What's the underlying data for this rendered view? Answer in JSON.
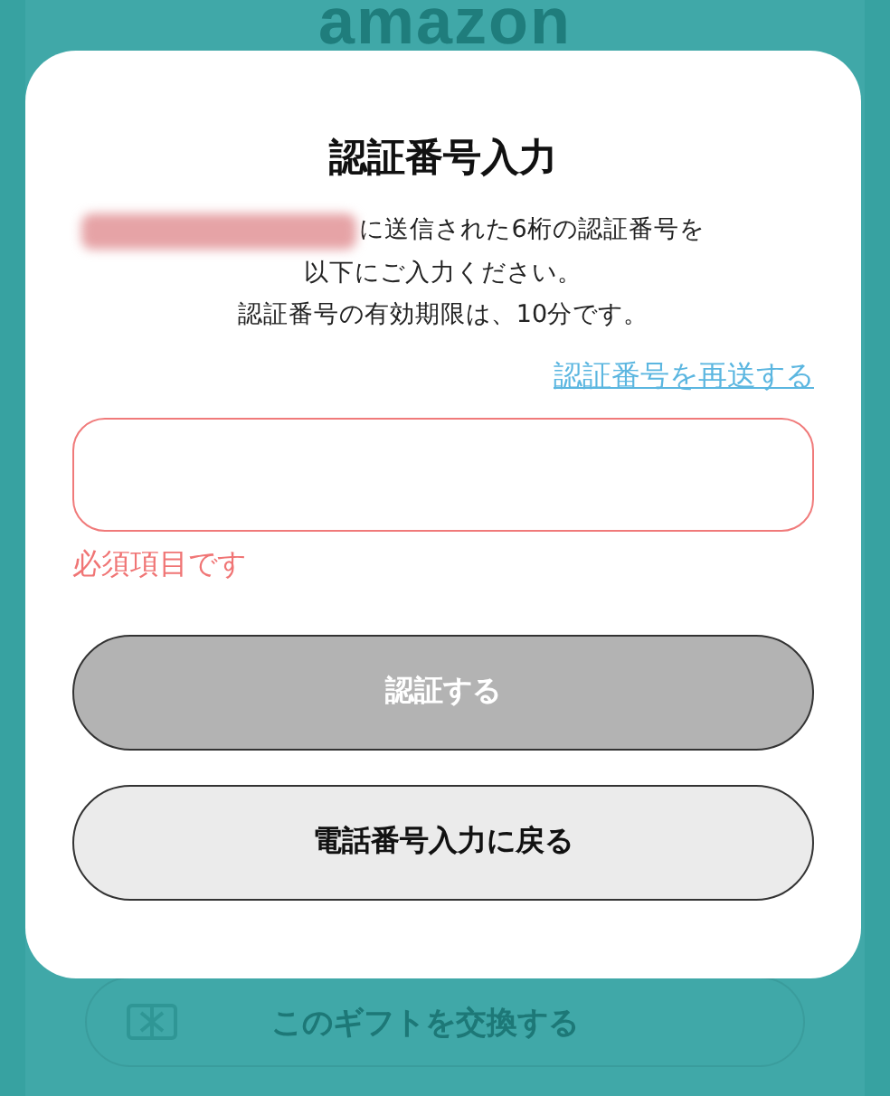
{
  "background": {
    "logo": "amazon",
    "exchange_button": "このギフトを交換する"
  },
  "dialog": {
    "title": "認証番号入力",
    "message_lines": [
      "に送信された6桁の認証番号を",
      "以下にご入力ください。",
      "認証番号の有効期限は、10分です。"
    ],
    "resend_link": "認証番号を再送する",
    "code_field": {
      "error": true
    },
    "error_message": "必須項目です",
    "buttons": [
      {
        "label": "認証する",
        "disabled": true
      },
      {
        "label": "電話番号入力に戻る",
        "disabled": false
      }
    ]
  }
}
